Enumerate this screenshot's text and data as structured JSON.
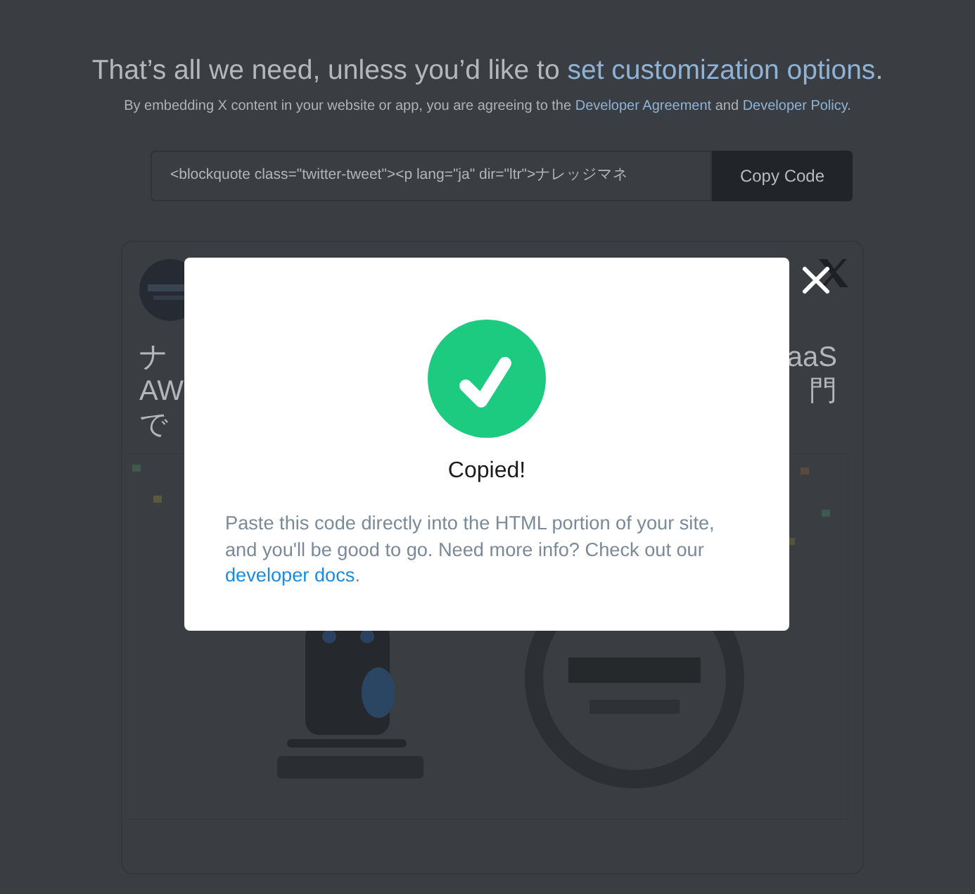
{
  "heading": [
    {
      "kind": "text",
      "text": "That’s all we need, unless you’d like to "
    },
    {
      "kind": "link",
      "text": "set customization options"
    },
    {
      "kind": "text",
      "text": "."
    }
  ],
  "notice": [
    {
      "kind": "text",
      "text": "By embedding X content in your website or app, you are agreeing to the "
    },
    {
      "kind": "link",
      "text": "Developer Agreement"
    },
    {
      "kind": "text",
      "text": " and "
    },
    {
      "kind": "link",
      "text": "Developer Policy"
    },
    {
      "kind": "text",
      "text": "."
    }
  ],
  "embed": {
    "code": "<blockquote class=\"twitter-tweet\"><p lang=\"ja\" dir=\"ltr\">ナレッジマネ",
    "button": "Copy Code"
  },
  "tweet": {
    "text_left": [
      "ナ",
      "AW",
      "で"
    ],
    "text_right": [
      "aaS",
      "門"
    ]
  },
  "modal": {
    "title": "Copied!",
    "message": [
      {
        "kind": "text",
        "text": "Paste this code directly into the HTML portion of your site, and you'll be good to go. Need more info? Check out our "
      },
      {
        "kind": "link",
        "text": "developer docs"
      },
      {
        "kind": "text",
        "text": "."
      }
    ]
  }
}
